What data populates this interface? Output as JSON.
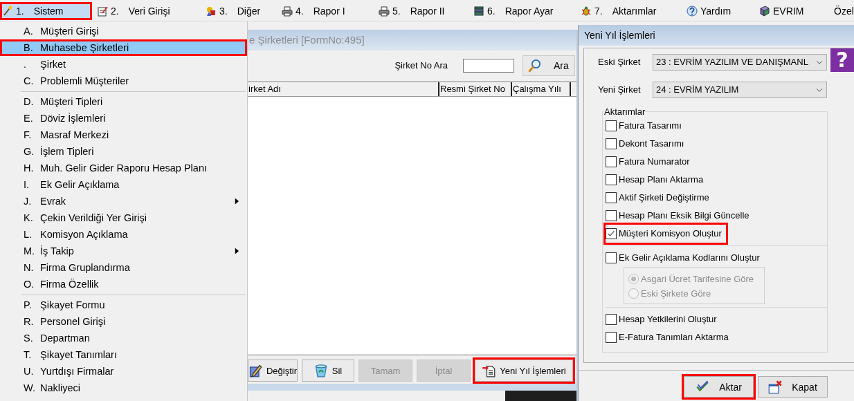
{
  "menubar": {
    "items": [
      {
        "number": "1.",
        "label": "Sistem",
        "selected": true,
        "highlighted": true
      },
      {
        "number": "2.",
        "label": "Veri Girişi",
        "selected": false,
        "highlighted": false
      },
      {
        "number": "3.",
        "label": "Diğer",
        "selected": false,
        "highlighted": false
      },
      {
        "number": "4.",
        "label": "Rapor I",
        "selected": false,
        "highlighted": false
      },
      {
        "number": "5.",
        "label": "Rapor II",
        "selected": false,
        "highlighted": false
      },
      {
        "number": "6.",
        "label": "Rapor Ayar",
        "selected": false,
        "highlighted": false
      },
      {
        "number": "7.",
        "label": "Aktarımlar",
        "selected": false,
        "highlighted": false
      },
      {
        "label": "Yardım",
        "selected": false,
        "highlighted": false
      },
      {
        "label": "EVRIM",
        "selected": false,
        "highlighted": false
      },
      {
        "label": "Özel",
        "selected": false,
        "highlighted": false
      }
    ]
  },
  "menu": {
    "sections": [
      {
        "items": [
          {
            "key": "A.",
            "label": "Müşteri Girişi",
            "selected": false,
            "highlighted": false,
            "submenu": false
          },
          {
            "key": "B.",
            "label": "Muhasebe Şirketleri",
            "selected": true,
            "highlighted": true,
            "submenu": false
          },
          {
            "key": ".",
            "label": "Şirket",
            "selected": false,
            "highlighted": false,
            "submenu": false
          },
          {
            "key": "C.",
            "label": "Problemli Müşteriler",
            "selected": false,
            "highlighted": false,
            "submenu": false
          }
        ]
      },
      {
        "items": [
          {
            "key": "D.",
            "label": "Müşteri Tipleri",
            "selected": false,
            "highlighted": false,
            "submenu": false
          },
          {
            "key": "E.",
            "label": "Döviz İşlemleri",
            "selected": false,
            "highlighted": false,
            "submenu": false
          },
          {
            "key": "F.",
            "label": "Masraf Merkezi",
            "selected": false,
            "highlighted": false,
            "submenu": false
          },
          {
            "key": "G.",
            "label": "İşlem Tipleri",
            "selected": false,
            "highlighted": false,
            "submenu": false
          },
          {
            "key": "H.",
            "label": "Muh. Gelir Gider Raporu Hesap Planı",
            "selected": false,
            "highlighted": false,
            "submenu": false
          },
          {
            "key": "I.",
            "label": "Ek Gelir Açıklama",
            "selected": false,
            "highlighted": false,
            "submenu": false
          },
          {
            "key": "J.",
            "label": "Evrak",
            "selected": false,
            "highlighted": false,
            "submenu": true
          },
          {
            "key": "K.",
            "label": "Çekin Verildiği Yer Girişi",
            "selected": false,
            "highlighted": false,
            "submenu": false
          },
          {
            "key": "L.",
            "label": "Komisyon Açıklama",
            "selected": false,
            "highlighted": false,
            "submenu": false
          },
          {
            "key": "M.",
            "label": "İş Takip",
            "selected": false,
            "highlighted": false,
            "submenu": true
          },
          {
            "key": "N.",
            "label": "Firma Gruplandırma",
            "selected": false,
            "highlighted": false,
            "submenu": false
          },
          {
            "key": "O.",
            "label": "Firma Özellik",
            "selected": false,
            "highlighted": false,
            "submenu": false
          }
        ]
      },
      {
        "items": [
          {
            "key": "P.",
            "label": "Şikayet Formu",
            "selected": false,
            "highlighted": false,
            "submenu": false
          },
          {
            "key": "R.",
            "label": "Personel Girişi",
            "selected": false,
            "highlighted": false,
            "submenu": false
          },
          {
            "key": "S.",
            "label": "Departman",
            "selected": false,
            "highlighted": false,
            "submenu": false
          },
          {
            "key": "T.",
            "label": "Şikayet Tanımları",
            "selected": false,
            "highlighted": false,
            "submenu": false
          },
          {
            "key": "U.",
            "label": "Yurtdışı Firmalar",
            "selected": false,
            "highlighted": false,
            "submenu": false
          },
          {
            "key": "W.",
            "label": "Nakliyeci",
            "selected": false,
            "highlighted": false,
            "submenu": false
          }
        ]
      }
    ]
  },
  "list_window": {
    "title": "e Şirketleri [FormNo:495]",
    "search": {
      "label": "Şirket No Ara",
      "button": "Ara"
    },
    "table": {
      "columns": [
        "irket Adı",
        "Resmi Şirket No",
        "Çalışma Yılı"
      ]
    },
    "buttons": [
      {
        "label": "Değiştir",
        "disabled": false,
        "highlighted": false
      },
      {
        "label": "Sil",
        "disabled": false,
        "highlighted": false
      },
      {
        "label": "Tamam",
        "disabled": true,
        "highlighted": false
      },
      {
        "label": "İptal",
        "disabled": true,
        "highlighted": false
      },
      {
        "label": "Yeni Yıl İşlemleri",
        "disabled": false,
        "highlighted": true
      }
    ]
  },
  "dialog": {
    "title": "Yeni Yıl İşlemleri",
    "help_button": "?",
    "fields": [
      {
        "label": "Eski Şirket",
        "value": "23 : EVRİM YAZILIM  VE DANIŞMANL"
      },
      {
        "label": "Yeni Şirket",
        "value": "24 : EVRİM YAZILIM"
      }
    ],
    "group": {
      "title": "Aktarımlar",
      "sections": [
        {
          "items": [
            {
              "label": "Fatura Tasarımı",
              "checked": false,
              "highlighted": false
            },
            {
              "label": "Dekont Tasarımı",
              "checked": false,
              "highlighted": false
            },
            {
              "label": "Fatura Numarator",
              "checked": false,
              "highlighted": false
            },
            {
              "label": "Hesap Planı Aktarma",
              "checked": false,
              "highlighted": false
            },
            {
              "label": "Aktif Şirketi Değiştirme",
              "checked": false,
              "highlighted": false
            },
            {
              "label": "Hesap Planı Eksik Bilgi Güncelle",
              "checked": false,
              "highlighted": false
            },
            {
              "label": "Müşteri Komisyon Oluştur",
              "checked": true,
              "highlighted": true
            }
          ]
        },
        {
          "items": [
            {
              "label": "Ek Gelir Açıklama Kodlarını Oluştur",
              "checked": false,
              "highlighted": false,
              "options": [
                {
                  "label": "Asgari Ücret Tarifesine Göre",
                  "selected": true,
                  "disabled": true
                },
                {
                  "label": "Eski Şirkete Göre",
                  "selected": false,
                  "disabled": true
                }
              ]
            }
          ]
        },
        {
          "items": [
            {
              "label": "Hesap Yetkilerini Oluştur",
              "checked": false,
              "highlighted": false
            },
            {
              "label": "E-Fatura Tanımları Aktarma",
              "checked": false,
              "highlighted": false
            }
          ]
        }
      ]
    },
    "buttons": [
      {
        "label": "Aktar",
        "highlighted": true
      },
      {
        "label": "Kapat",
        "highlighted": false
      }
    ]
  }
}
